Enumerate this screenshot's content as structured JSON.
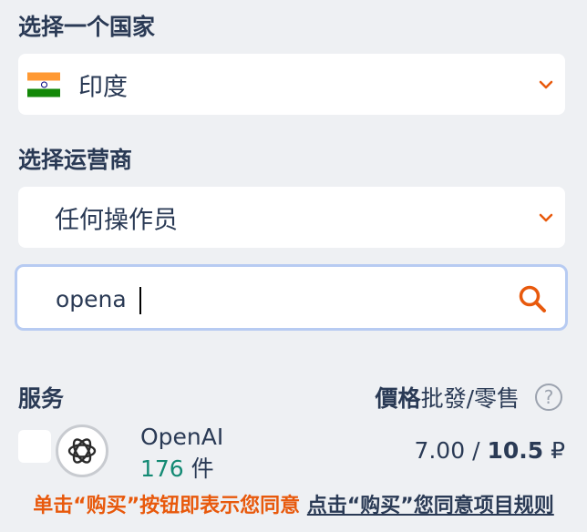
{
  "country": {
    "label": "选择一个国家",
    "selected": "印度",
    "flag_icon": "india-flag-icon"
  },
  "operator": {
    "label": "选择运营商",
    "selected": "任何操作员"
  },
  "search": {
    "value": "opena",
    "icon": "search-icon"
  },
  "table": {
    "service_header": "服务",
    "price_header_bold": "價格",
    "price_header_rest": "批發/零售",
    "help_symbol": "?"
  },
  "service": {
    "name": "OpenAI",
    "count": "176",
    "count_unit": "件",
    "wholesale": "7.00",
    "separator": "/",
    "retail": "10.5",
    "currency": "₽",
    "logo_icon": "openai-logo-icon"
  },
  "notice": {
    "text": "单击“购买”按钮即表示您同意",
    "link": "点击“购买”您同意项目规则"
  },
  "colors": {
    "accent": "#e8590c",
    "text": "#2a3a55",
    "background": "#eef0f3",
    "count": "#148a74",
    "focus_border": "#b7cbf2"
  }
}
